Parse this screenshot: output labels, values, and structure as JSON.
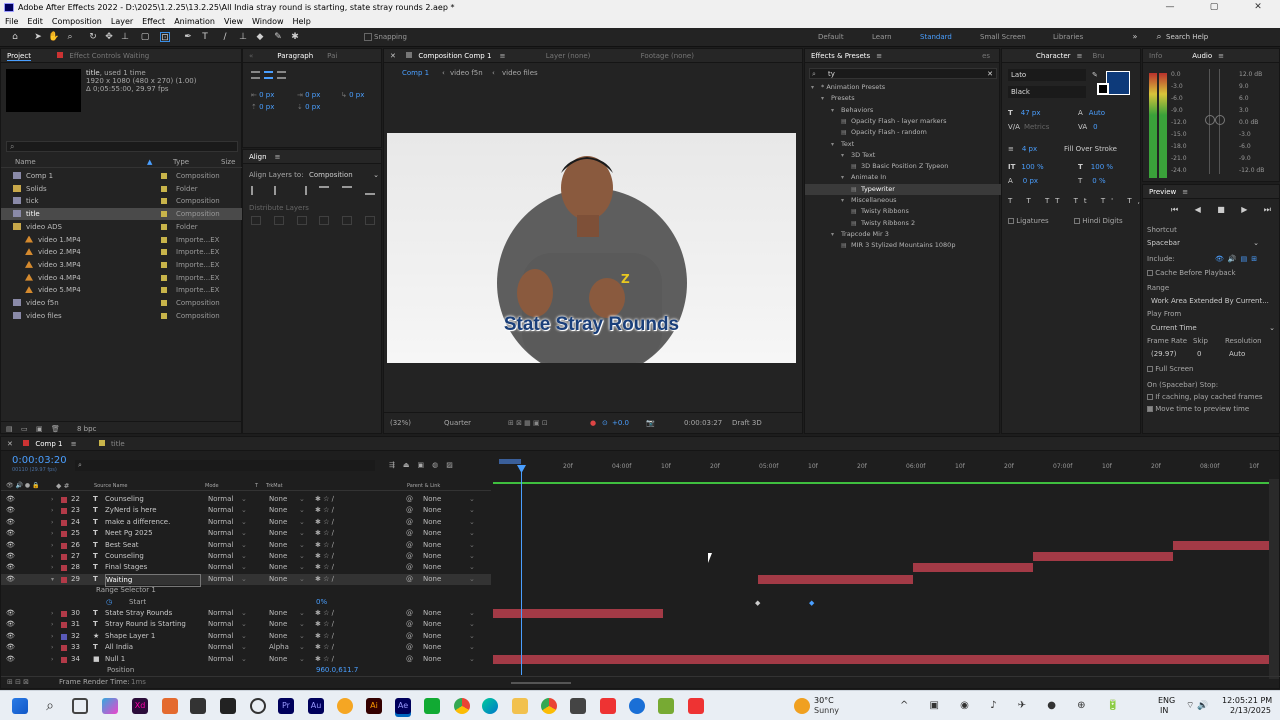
{
  "title": "Adobe After Effects 2022 - D:\\2025\\1.2.25\\13.2.25\\All India stray round is starting, state stray rounds 2.aep *",
  "menu": [
    "File",
    "Edit",
    "Composition",
    "Layer",
    "Effect",
    "Animation",
    "View",
    "Window",
    "Help"
  ],
  "toolbar": {
    "snapping": "Snapping",
    "workspaces": [
      "Default",
      "Learn",
      "Standard",
      "Small Screen",
      "Libraries"
    ],
    "search_placeholder": "Search Help"
  },
  "project": {
    "tab": "Project",
    "tab2": "Effect Controls Waiting",
    "selected_name": "title",
    "selected_used": ", used 1 time",
    "selected_size": "1920 x 1080 (480 x 270) (1.00)",
    "selected_dur": "Δ 0;05:55:00, 29.97 fps",
    "col_name": "Name",
    "col_type": "Type",
    "col_size": "Size",
    "items": [
      {
        "name": "Comp 1",
        "type": "Composition",
        "color": "#c8b44a",
        "kind": "comp"
      },
      {
        "name": "Solids",
        "type": "Folder",
        "color": "#c8b44a",
        "kind": "folder"
      },
      {
        "name": "tick",
        "type": "Composition",
        "color": "#c8b44a",
        "kind": "comp"
      },
      {
        "name": "title",
        "type": "Composition",
        "color": "#c8b44a",
        "kind": "comp"
      },
      {
        "name": "video ADS",
        "type": "Folder",
        "color": "#c8b44a",
        "kind": "folder"
      },
      {
        "name": "video 1.MP4",
        "type": "Importe...EX",
        "color": "#c8b44a",
        "kind": "media"
      },
      {
        "name": "video 2.MP4",
        "type": "Importe...EX",
        "color": "#c8b44a",
        "kind": "media"
      },
      {
        "name": "video 3.MP4",
        "type": "Importe...EX",
        "color": "#c8b44a",
        "kind": "media"
      },
      {
        "name": "video 4.MP4",
        "type": "Importe...EX",
        "color": "#c8b44a",
        "kind": "media"
      },
      {
        "name": "video 5.MP4",
        "type": "Importe...EX",
        "color": "#c8b44a",
        "kind": "media"
      },
      {
        "name": "video f5n",
        "type": "Composition",
        "color": "#c8b44a",
        "kind": "comp"
      },
      {
        "name": "video files",
        "type": "Composition",
        "color": "#c8b44a",
        "kind": "comp"
      }
    ],
    "bpc": "8 bpc"
  },
  "paragraph": {
    "tab": "Paragraph",
    "tab2": "Pai",
    "px_values": [
      "0 px",
      "0 px",
      "0 px",
      "0 px",
      "0 px"
    ]
  },
  "align": {
    "tab": "Align",
    "align_to_label": "Align Layers to:",
    "align_to": "Composition",
    "distribute": "Distribute Layers"
  },
  "composition": {
    "tab": "Composition Comp 1",
    "layer_tab": "Layer (none)",
    "footage_tab": "Footage (none)",
    "breadcrumbs": [
      "Comp 1",
      "video f5n",
      "video files"
    ],
    "caption": "State Stray Rounds",
    "zoom": "(32%)",
    "resolution": "Quarter",
    "timecode": "0:00:03:27",
    "renderer": "Draft 3D",
    "exposure": "+0.0"
  },
  "effects": {
    "tab": "Effects & Presets",
    "search": "ty",
    "tree": [
      {
        "label": "* Animation Presets",
        "depth": 0
      },
      {
        "label": "Presets",
        "depth": 1
      },
      {
        "label": "Behaviors",
        "depth": 2
      },
      {
        "label": "Opacity Flash - layer markers",
        "depth": 3
      },
      {
        "label": "Opacity Flash - random",
        "depth": 3
      },
      {
        "label": "Text",
        "depth": 2
      },
      {
        "label": "3D Text",
        "depth": 3
      },
      {
        "label": "3D Basic Position Z Typeon",
        "depth": 4
      },
      {
        "label": "Animate In",
        "depth": 3
      },
      {
        "label": "Typewriter",
        "depth": 4,
        "selected": true
      },
      {
        "label": "Miscellaneous",
        "depth": 3
      },
      {
        "label": "Twisty Ribbons",
        "depth": 4
      },
      {
        "label": "Twisty Ribbons 2",
        "depth": 4
      },
      {
        "label": "Trapcode Mir 3",
        "depth": 2
      },
      {
        "label": "MIR 3 Stylized Mountains 1080p",
        "depth": 3
      }
    ]
  },
  "character": {
    "tab": "Character",
    "tab2": "Bru",
    "font": "Lato",
    "style": "Black",
    "size": "47 px",
    "leading": "Auto",
    "kerning": "Metrics",
    "tracking": "0",
    "stroke": "4 px",
    "stroke_mode": "Fill Over Stroke",
    "vscale": "100 %",
    "hscale": "100 %",
    "baseline": "0 px",
    "tsume": "0 %",
    "ligatures": "Ligatures",
    "hindi": "Hindi Digits",
    "fill_color": "#0d3a7a"
  },
  "info": {
    "tab": "Info",
    "audio_tab": "Audio",
    "db_left": [
      "0.0",
      "-3.0",
      "-6.0",
      "-9.0",
      "-12.0",
      "-15.0",
      "-18.0",
      "-21.0",
      "-24.0"
    ],
    "db_right": [
      "12.0 dB",
      "9.0",
      "6.0",
      "3.0",
      "0.0 dB",
      "-3.0",
      "-6.0",
      "-9.0",
      "-12.0 dB"
    ]
  },
  "preview": {
    "tab": "Preview",
    "shortcut_label": "Shortcut",
    "shortcut": "Spacebar",
    "include": "Include:",
    "cache": "Cache Before Playback",
    "range_label": "Range",
    "range": "Work Area Extended By Current...",
    "playfrom_label": "Play From",
    "playfrom": "Current Time",
    "framerate_label": "Frame Rate",
    "skip_label": "Skip",
    "resolution_label": "Resolution",
    "framerate": "(29.97)",
    "skip": "0",
    "resolution": "Auto",
    "fullscreen": "Full Screen",
    "stop_label": "On (Spacebar) Stop:",
    "stop1": "If caching, play cached frames",
    "stop2": "Move time to preview time"
  },
  "timeline": {
    "tab": "Comp 1",
    "tab2": "title",
    "timecode": "0:00:03:20",
    "frames": "00110 (29.97 fps)",
    "cols": {
      "source": "Source Name",
      "mode": "Mode",
      "t": "T",
      "trkmat": "TrkMat",
      "parent": "Parent & Link"
    },
    "ruler": [
      "20f",
      "04:00f",
      "10f",
      "20f",
      "05:00f",
      "10f",
      "20f",
      "06:00f",
      "10f",
      "20f",
      "07:00f",
      "10f",
      "20f",
      "08:00f",
      "10f"
    ],
    "layers": [
      {
        "num": "22",
        "icon": "T",
        "name": "Counseling",
        "mode": "Normal",
        "trk": "None",
        "parent": "None",
        "color": "#b23a48"
      },
      {
        "num": "23",
        "icon": "T",
        "name": "ZyNerd is here",
        "mode": "Normal",
        "trk": "None",
        "parent": "None",
        "color": "#b23a48"
      },
      {
        "num": "24",
        "icon": "T",
        "name": "make a difference.",
        "mode": "Normal",
        "trk": "None",
        "parent": "None",
        "color": "#b23a48"
      },
      {
        "num": "25",
        "icon": "T",
        "name": "Neet Pg 2025",
        "mode": "Normal",
        "trk": "None",
        "parent": "None",
        "color": "#b23a48"
      },
      {
        "num": "26",
        "icon": "T",
        "name": "Best Seat",
        "mode": "Normal",
        "trk": "None",
        "parent": "None",
        "color": "#b23a48"
      },
      {
        "num": "27",
        "icon": "T",
        "name": "Counseling",
        "mode": "Normal",
        "trk": "None",
        "parent": "None",
        "color": "#b23a48"
      },
      {
        "num": "28",
        "icon": "T",
        "name": "Final Stages",
        "mode": "Normal",
        "trk": "None",
        "parent": "None",
        "color": "#b23a48"
      },
      {
        "num": "29",
        "icon": "T",
        "name": "Waiting",
        "mode": "Normal",
        "trk": "None",
        "parent": "None",
        "color": "#b23a48"
      },
      {
        "num": "",
        "icon": "",
        "name": "Range Selector 1",
        "mode": "",
        "trk": "",
        "parent": "",
        "color": ""
      },
      {
        "num": "",
        "icon": "",
        "name": "Start",
        "mode": "",
        "trk": "",
        "parent": "",
        "color": "",
        "value": "0%"
      },
      {
        "num": "30",
        "icon": "T",
        "name": "State Stray Rounds",
        "mode": "Normal",
        "trk": "None",
        "parent": "None",
        "color": "#b23a48"
      },
      {
        "num": "31",
        "icon": "T",
        "name": "Stray Round is Starting",
        "mode": "Normal",
        "trk": "None",
        "parent": "None",
        "color": "#b23a48"
      },
      {
        "num": "32",
        "icon": "★",
        "name": "Shape Layer 1",
        "mode": "Normal",
        "trk": "None",
        "parent": "None",
        "color": "#5a5ab8"
      },
      {
        "num": "33",
        "icon": "T",
        "name": "All India",
        "mode": "Normal",
        "trk": "Alpha",
        "parent": "None",
        "color": "#b23a48"
      },
      {
        "num": "34",
        "icon": "■",
        "name": "Null 1",
        "mode": "Normal",
        "trk": "None",
        "parent": "None",
        "color": "#b23a48"
      },
      {
        "num": "",
        "icon": "",
        "name": "Position",
        "mode": "",
        "trk": "",
        "parent": "",
        "color": "",
        "value": "960.0,611.7"
      }
    ],
    "footer": "Frame Render Time:",
    "footer_val": "1ms"
  },
  "taskbar": {
    "weather_temp": "30°C",
    "weather_desc": "Sunny",
    "lang": "ENG",
    "lang2": "IN",
    "time": "12:05:21 PM",
    "date": "2/13/2025"
  }
}
